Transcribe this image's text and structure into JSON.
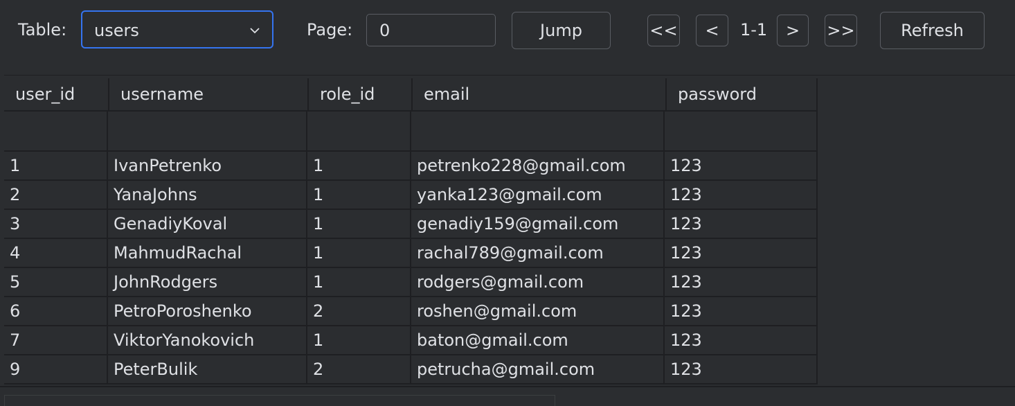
{
  "toolbar": {
    "table_label": "Table:",
    "table_selected": "users",
    "page_label": "Page:",
    "page_value": "0",
    "jump_label": "Jump",
    "first_label": "<<",
    "prev_label": "<",
    "page_range": "1-1",
    "next_label": ">",
    "last_label": ">>",
    "refresh_label": "Refresh"
  },
  "table": {
    "columns": [
      "user_id",
      "username",
      "role_id",
      "email",
      "password"
    ],
    "rows": [
      [
        "1",
        "IvanPetrenko",
        "1",
        "petrenko228@gmail.com",
        "123"
      ],
      [
        "2",
        "YanaJohns",
        "1",
        "yanka123@gmail.com",
        "123"
      ],
      [
        "3",
        "GenadiyKoval",
        "1",
        "genadiy159@gmail.com",
        "123"
      ],
      [
        "4",
        "MahmudRachal",
        "1",
        "rachal789@gmail.com",
        "123"
      ],
      [
        "5",
        "JohnRodgers",
        "1",
        "rodgers@gmail.com",
        "123"
      ],
      [
        "6",
        "PetroPoroshenko",
        "2",
        "roshen@gmail.com",
        "123"
      ],
      [
        "7",
        "ViktorYanokovich",
        "1",
        "baton@gmail.com",
        "123"
      ],
      [
        "9",
        "PeterBulik",
        "2",
        "petrucha@gmail.com",
        "123"
      ]
    ]
  }
}
